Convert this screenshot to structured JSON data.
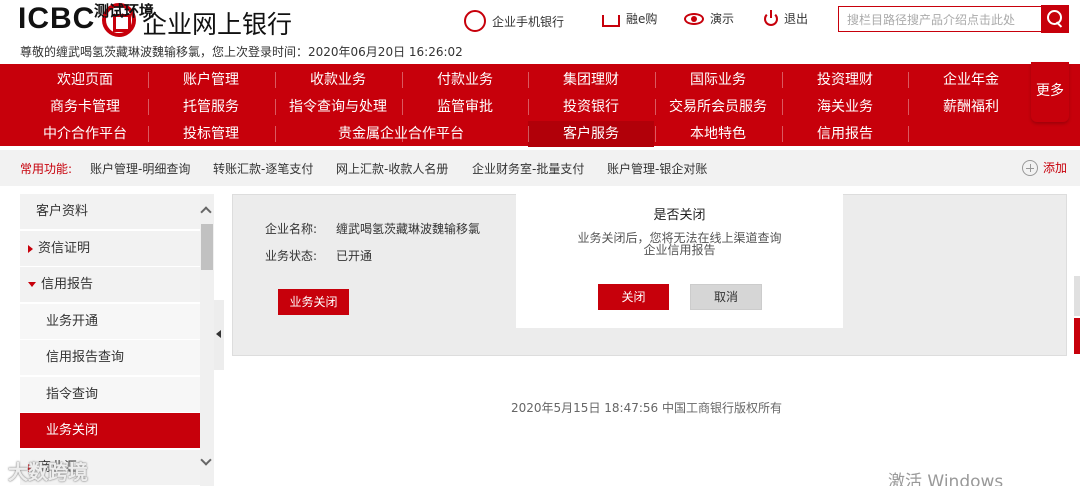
{
  "header": {
    "logo_brand": "ICBC",
    "logo_overlay": "测试环境",
    "logo_title": "企业网上银行",
    "greeting": "尊敬的缠武喝氢茨藏琳波魏输移氯，您上次登录时间：2020年06月20日 16:26:02",
    "links": {
      "mobile": "企业手机银行",
      "rongegou": "融e购",
      "demo": "演示",
      "logout": "退出"
    },
    "search_placeholder": "搜栏目路径搜产品介绍点击此处"
  },
  "nav": {
    "row1": [
      "欢迎页面",
      "账户管理",
      "收款业务",
      "付款业务",
      "集团理财",
      "国际业务",
      "投资理财",
      "企业年金"
    ],
    "row2": [
      "商务卡管理",
      "托管服务",
      "指令查询与处理",
      "监管审批",
      "投资银行",
      "交易所会员服务",
      "海关业务",
      "薪酬福利"
    ],
    "row3": [
      "中介合作平台",
      "投标管理",
      "贵金属企业合作平台",
      "客户服务",
      "本地特色",
      "信用报告"
    ],
    "more": "更多",
    "active": "客户服务"
  },
  "quickbar": {
    "label": "常用功能:",
    "items": [
      "账户管理-明细查询",
      "转账汇款-逐笔支付",
      "网上汇款-收款人名册",
      "企业财务室-批量支付",
      "账户管理-银企对账"
    ],
    "add": "添加"
  },
  "sidebar": {
    "items": [
      {
        "label": "客户资料"
      },
      {
        "label": "资信证明"
      },
      {
        "label": "信用报告"
      },
      {
        "label": "业务开通"
      },
      {
        "label": "信用报告查询"
      },
      {
        "label": "指令查询"
      },
      {
        "label": "业务关闭"
      },
      {
        "label": "商业汇"
      }
    ]
  },
  "content": {
    "company_label": "企业名称:",
    "company_value": "缠武喝氢茨藏琳波魏输移氯",
    "status_label": "业务状态:",
    "status_value": "已开通",
    "close_button": "业务关闭"
  },
  "dialog": {
    "title": "是否关闭",
    "message": "业务关闭后，您将无法在线上渠道查询企业信用报告",
    "confirm": "关闭",
    "cancel": "取消"
  },
  "footer": "2020年5月15日 18:47:56   中国工商银行版权所有",
  "overlay_watermark": "大数跨境",
  "activate_windows": "激活 Windows",
  "colors": {
    "brand_red": "#c7000b",
    "panel_gray": "#ececec"
  }
}
